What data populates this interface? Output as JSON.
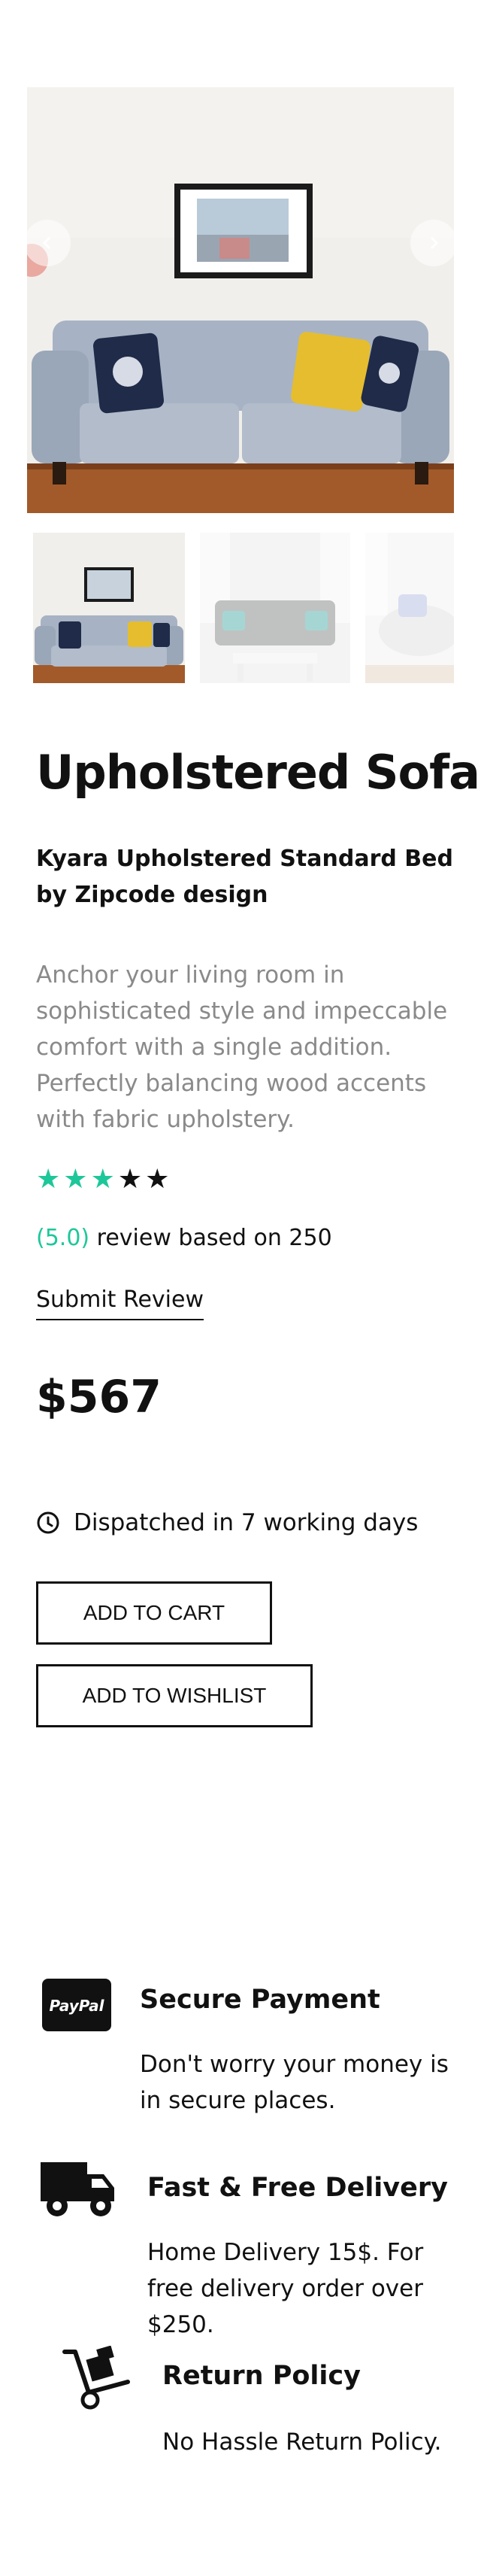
{
  "gallery": {
    "prev_icon": "chevron-left-icon",
    "next_icon": "chevron-right-icon",
    "thumbnails": [
      "sofa-blue-grey",
      "sofa-tufted-grey",
      "armchair-white"
    ]
  },
  "product": {
    "title": "Upholstered Sofa",
    "subtitle": "Kyara Upholstered Standard Bed by Zipcode design",
    "description": "Anchor your living room in sophisticated style and impeccable comfort with a single addition. Perfectly balancing wood accents with fabric upholstery.",
    "rating": {
      "value": 3,
      "max": 5
    },
    "review_score": "(5.0)",
    "review_text": " review based on 250",
    "submit_review": "Submit Review",
    "price": "$567",
    "dispatch": "Dispatched in 7 working days",
    "add_to_cart": "ADD TO CART",
    "add_to_wishlist": "ADD TO WISHLIST"
  },
  "features": [
    {
      "icon": "paypal-icon",
      "icon_text": "PayPal",
      "title": "Secure Payment",
      "text": "Don't worry your money is in secure places."
    },
    {
      "icon": "delivery-truck-icon",
      "title": "Fast & Free Delivery",
      "text": "Home Delivery 15$. For free delivery order over $250."
    },
    {
      "icon": "hand-truck-icon",
      "title": "Return Policy",
      "text": "No Hassle Return Policy."
    }
  ],
  "colors": {
    "accent": "#1ec79a",
    "text": "#111111",
    "muted": "#8a8a8a"
  }
}
